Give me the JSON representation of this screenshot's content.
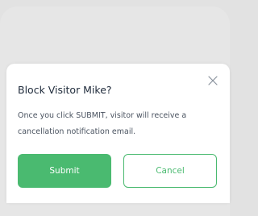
{
  "dialog": {
    "title": "Block Visitor Mike?",
    "message": "Once you click SUBMIT, visitor will receive a cancellation notification email.",
    "close_icon": "close-icon",
    "submit_label": "Submit",
    "cancel_label": "Cancel"
  },
  "colors": {
    "accent": "#4aba70",
    "title_text": "#1e2a3a",
    "body_text": "#4a5360",
    "overlay": "#e2e2e2"
  }
}
